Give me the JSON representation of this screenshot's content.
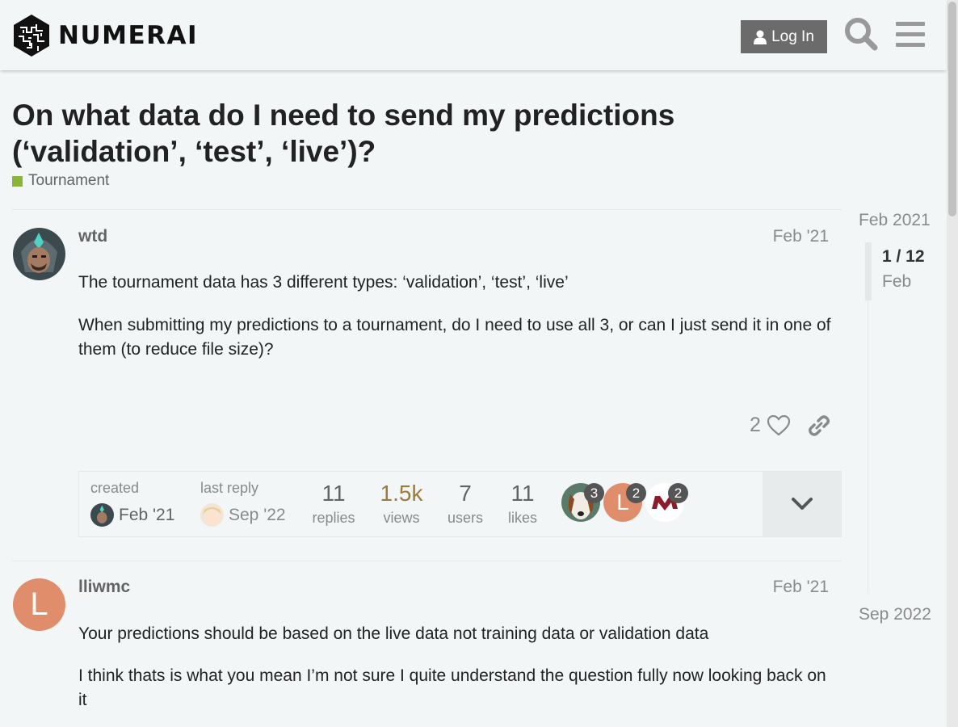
{
  "header": {
    "brand": "NUMERAI",
    "login_label": "Log In",
    "search_icon": "search-icon",
    "menu_icon": "hamburger-menu-icon"
  },
  "topic": {
    "title": "On what data do I need to send my predictions (‘validation’, ‘test’, ‘live’)?",
    "category": "Tournament",
    "category_color": "#8ab53a"
  },
  "posts": [
    {
      "username": "wtd",
      "date": "Feb '21",
      "paragraphs": [
        "The tournament data has 3 different types: ‘validation’, ‘test’, ‘live’",
        "When submitting my predictions to a tournament, do I need to use all 3, or can I just send it in one of them (to reduce file size)?"
      ],
      "like_count": "2"
    },
    {
      "username": "lliwmc",
      "avatar_letter": "L",
      "avatar_color": "#e08d6b",
      "date": "Feb '21",
      "paragraphs": [
        "Your predictions should be based on the live data not training data or validation data",
        "I think thats is what you mean I’m not sure I quite understand the question fully now looking back on it"
      ]
    }
  ],
  "topic_map": {
    "created_label": "created",
    "created_date": "Feb '21",
    "last_reply_label": "last reply",
    "last_reply_date": "Sep '22",
    "stats": [
      {
        "value": "11",
        "label": "replies"
      },
      {
        "value": "1.5k",
        "label": "views"
      },
      {
        "value": "7",
        "label": "users"
      },
      {
        "value": "11",
        "label": "likes"
      }
    ],
    "participants": [
      {
        "count": "3"
      },
      {
        "letter": "L",
        "count": "2"
      },
      {
        "count": "2"
      }
    ]
  },
  "timeline": {
    "start": "Feb 2021",
    "position": "1 / 12",
    "month": "Feb",
    "end": "Sep 2022"
  }
}
